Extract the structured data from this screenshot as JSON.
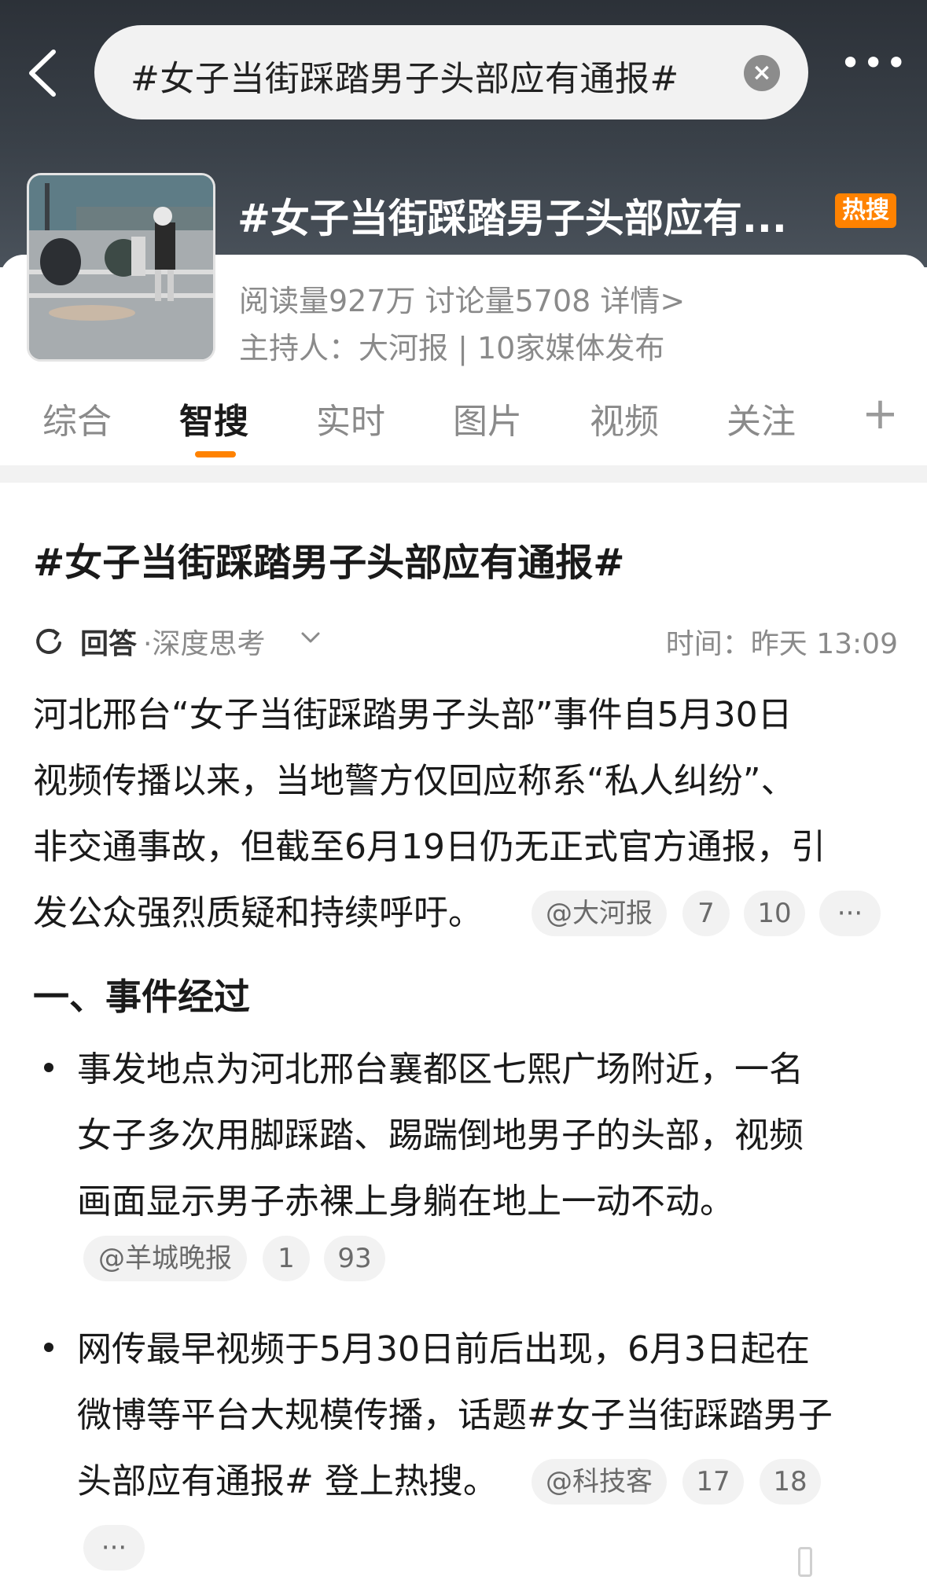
{
  "search": {
    "query": "#女子当街踩踏男子头部应有通报#",
    "clear_symbol": "×",
    "more_symbol": "•••"
  },
  "topic": {
    "title": "#女子当街踩踏男子头部应有...",
    "hot_badge": "热搜",
    "stats": "阅读量927万   讨论量5708   详情>",
    "host": "主持人：大河报 | 10家媒体发布"
  },
  "tabs": [
    {
      "label": "综合"
    },
    {
      "label": "智搜"
    },
    {
      "label": "实时"
    },
    {
      "label": "图片"
    },
    {
      "label": "视频"
    },
    {
      "label": "关注"
    }
  ],
  "tab_plus": "+",
  "article": {
    "title": "#女子当街踩踏男子头部应有通报#",
    "answer_label": "回答",
    "mode_label": "·深度思考",
    "time": "时间：昨天 13:09",
    "intro_lines": [
      "河北邢台“女子当街踩踏男子头部”事件自5月30日",
      "视频传播以来，当地警方仅回应称系“私人纠纷”、",
      "非交通事故，但截至6月19日仍无正式官方通报，引",
      "发公众强烈质疑和持续呼吁。"
    ],
    "intro_chips": [
      "@大河报",
      "7",
      "10",
      "···"
    ],
    "section1_title": "一、事件经过",
    "bullet1_lines": [
      "事发地点为河北邢台襄都区七熙广场附近，一名",
      "女子多次用脚踩踏、踢踹倒地男子的头部，视频",
      "画面显示男子赤裸上身躺在地上一动不动。"
    ],
    "bullet1_chips": [
      "@羊城晚报",
      "1",
      "93"
    ],
    "bullet2_lines": [
      "网传最早视频于5月30日前后出现，6月3日起在",
      "微博等平台大规模传播，话题#女子当街踩踏男子",
      "头部应有通报# 登上热搜。"
    ],
    "bullet2_chips": [
      "@科技客",
      "17",
      "18"
    ],
    "bullet2_more": "···"
  },
  "colors": {
    "accent": "#ff8200",
    "header_bg": "#3a4149",
    "muted": "#8a8a8a"
  }
}
